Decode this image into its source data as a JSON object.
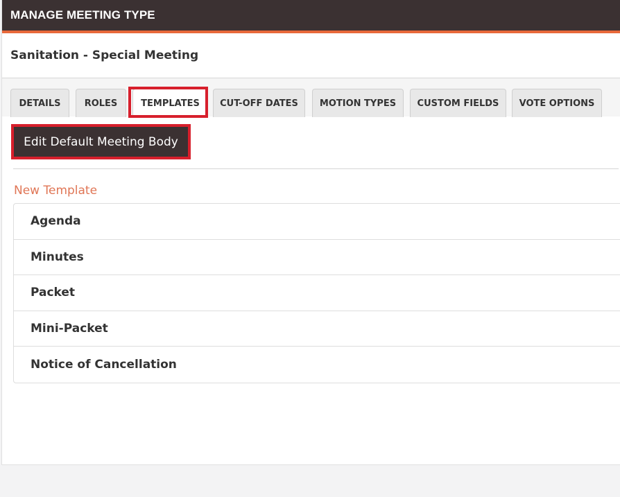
{
  "header": {
    "title": "MANAGE MEETING TYPE"
  },
  "meeting_type": {
    "name": "Sanitation - Special Meeting"
  },
  "tabs": [
    {
      "label": "DETAILS",
      "active": false
    },
    {
      "label": "ROLES",
      "active": false
    },
    {
      "label": "TEMPLATES",
      "active": true
    },
    {
      "label": "CUT-OFF DATES",
      "active": false
    },
    {
      "label": "MOTION TYPES",
      "active": false
    },
    {
      "label": "CUSTOM FIELDS",
      "active": false
    },
    {
      "label": "VOTE OPTIONS",
      "active": false
    }
  ],
  "templates_tab": {
    "edit_body_button": "Edit Default Meeting Body",
    "new_template_link": "New Template",
    "templates": [
      {
        "label": "Agenda"
      },
      {
        "label": "Minutes"
      },
      {
        "label": "Packet"
      },
      {
        "label": "Mini-Packet"
      },
      {
        "label": "Notice of Cancellation"
      }
    ]
  },
  "colors": {
    "header_bg": "#3b3132",
    "accent": "#e8693b",
    "link": "#e07656",
    "highlight_outline": "#d71f2c"
  }
}
